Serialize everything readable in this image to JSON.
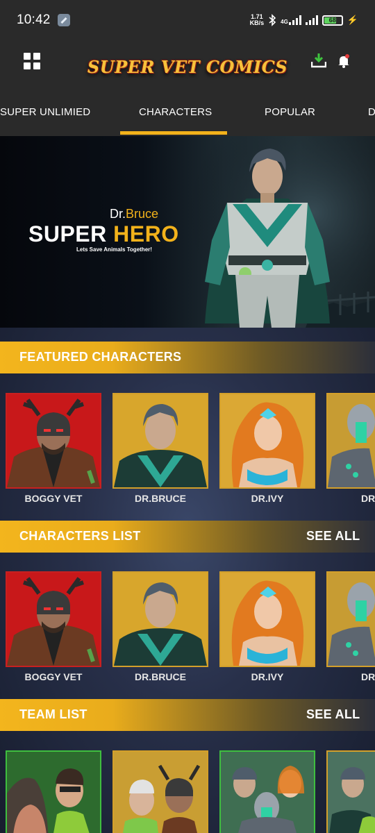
{
  "status_bar": {
    "time": "10:42",
    "speed_value": "1.71",
    "speed_unit": "KB/s",
    "network": "4G",
    "battery": "68"
  },
  "header": {
    "logo_text": "SUPER VET COMICS",
    "icons": [
      "grid-menu-icon",
      "download-icon",
      "bell-icon"
    ]
  },
  "tabs": {
    "items": [
      {
        "label": "SUPER UNLIMIED"
      },
      {
        "label": "CHARACTERS"
      },
      {
        "label": "POPULAR"
      },
      {
        "label": "D"
      }
    ],
    "active": "CHARACTERS"
  },
  "banner": {
    "name_prefix": "Dr.",
    "name_highlight": "Bruce",
    "title_word1": "SUPER",
    "title_word2": "HERO",
    "tagline": "Lets Save Animals Together!"
  },
  "sections": {
    "featured": {
      "title": "FEATURED CHARACTERS",
      "items": [
        {
          "name": "BOGGY VET"
        },
        {
          "name": "DR.BRUCE"
        },
        {
          "name": "DR.IVY"
        },
        {
          "name": "DR"
        }
      ]
    },
    "characters_list": {
      "title": "CHARACTERS LIST",
      "see_all": "SEE ALL",
      "items": [
        {
          "name": "BOGGY VET"
        },
        {
          "name": "DR.BRUCE"
        },
        {
          "name": "DR.IVY"
        },
        {
          "name": "DR"
        }
      ]
    },
    "team_list": {
      "title": "TEAM LIST",
      "see_all": "SEE ALL"
    }
  },
  "colors": {
    "accent": "#f2b21b",
    "header_bg": "#2a2a2a",
    "card_red": "#c82020",
    "card_gold": "#d4a02a",
    "card_green": "#3fbf3f"
  }
}
